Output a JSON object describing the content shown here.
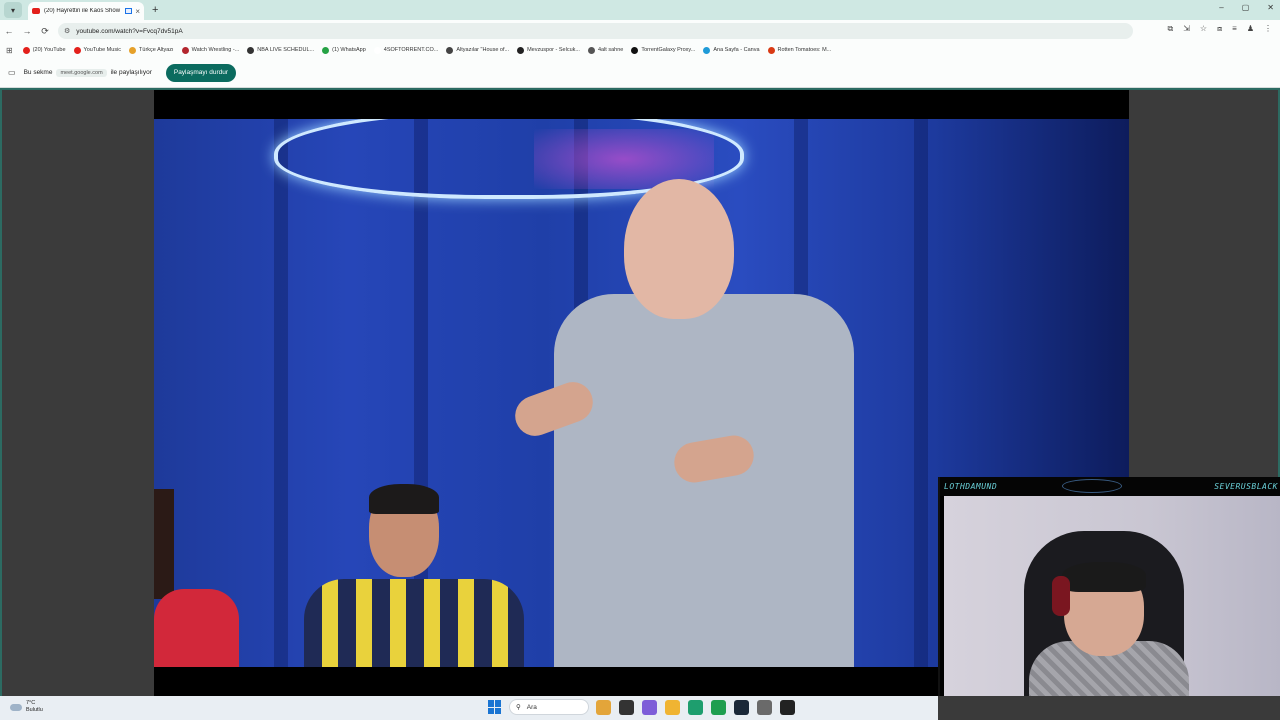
{
  "browser": {
    "tab": {
      "title": "(20) Hayrettin ile Kaos Show",
      "close": "×"
    },
    "new_tab": "+",
    "window_controls": [
      "–",
      "▢",
      "✕"
    ],
    "address": "youtube.com/watch?v=Fvcq7dv51pA",
    "nav": {
      "back": "←",
      "forward": "→",
      "reload": "⟳"
    },
    "toolbar_icons": [
      "⧉",
      "⇲",
      "☆",
      "⧈",
      "≡",
      "♟",
      "⋮"
    ]
  },
  "bookmarks": [
    {
      "label": "(20) YouTube",
      "color": "#e3201b"
    },
    {
      "label": "YouTube Music",
      "color": "#e3201b"
    },
    {
      "label": "Türkçe Altyazı",
      "color": "#e6a12a"
    },
    {
      "label": "Watch Wrestling -...",
      "color": "#b3262e"
    },
    {
      "label": "NBA LIVE SCHEDUL...",
      "color": "#333333"
    },
    {
      "label": "(1) WhatsApp",
      "color": "#25a244"
    },
    {
      "label": "4SOFTORRENT.CO...",
      "color": "#ffffff"
    },
    {
      "label": "Altyazılar \"House of...",
      "color": "#444444"
    },
    {
      "label": "Mevzuspor - Selcuk...",
      "color": "#222222"
    },
    {
      "label": "4alt sahne",
      "color": "#555555"
    },
    {
      "label": "TorrentGalaxy Proxy...",
      "color": "#111111"
    },
    {
      "label": "Ana Sayfa - Canva",
      "color": "#1f9bd8"
    },
    {
      "label": "Rotten Tomatoes: M...",
      "color": "#d93a14"
    }
  ],
  "share_bar": {
    "prefix": "Bu sekme",
    "domain": "meet.google.com",
    "suffix": "ile paylaşılıyor",
    "stop_button": "Paylaşmayı durdur"
  },
  "webcam": {
    "left_name": "LOTHDAMUND",
    "right_name": "SEVERUSBLACK"
  },
  "taskbar": {
    "temperature": "7°C",
    "condition": "Bulutlu",
    "search_placeholder": "Ara",
    "apps": [
      "#e3a53a",
      "#333333",
      "#7d5dd8",
      "#f0b432",
      "#1e9e6e",
      "#1f9e4f",
      "#1b2838",
      "#6a6a6a",
      "#222222"
    ]
  }
}
